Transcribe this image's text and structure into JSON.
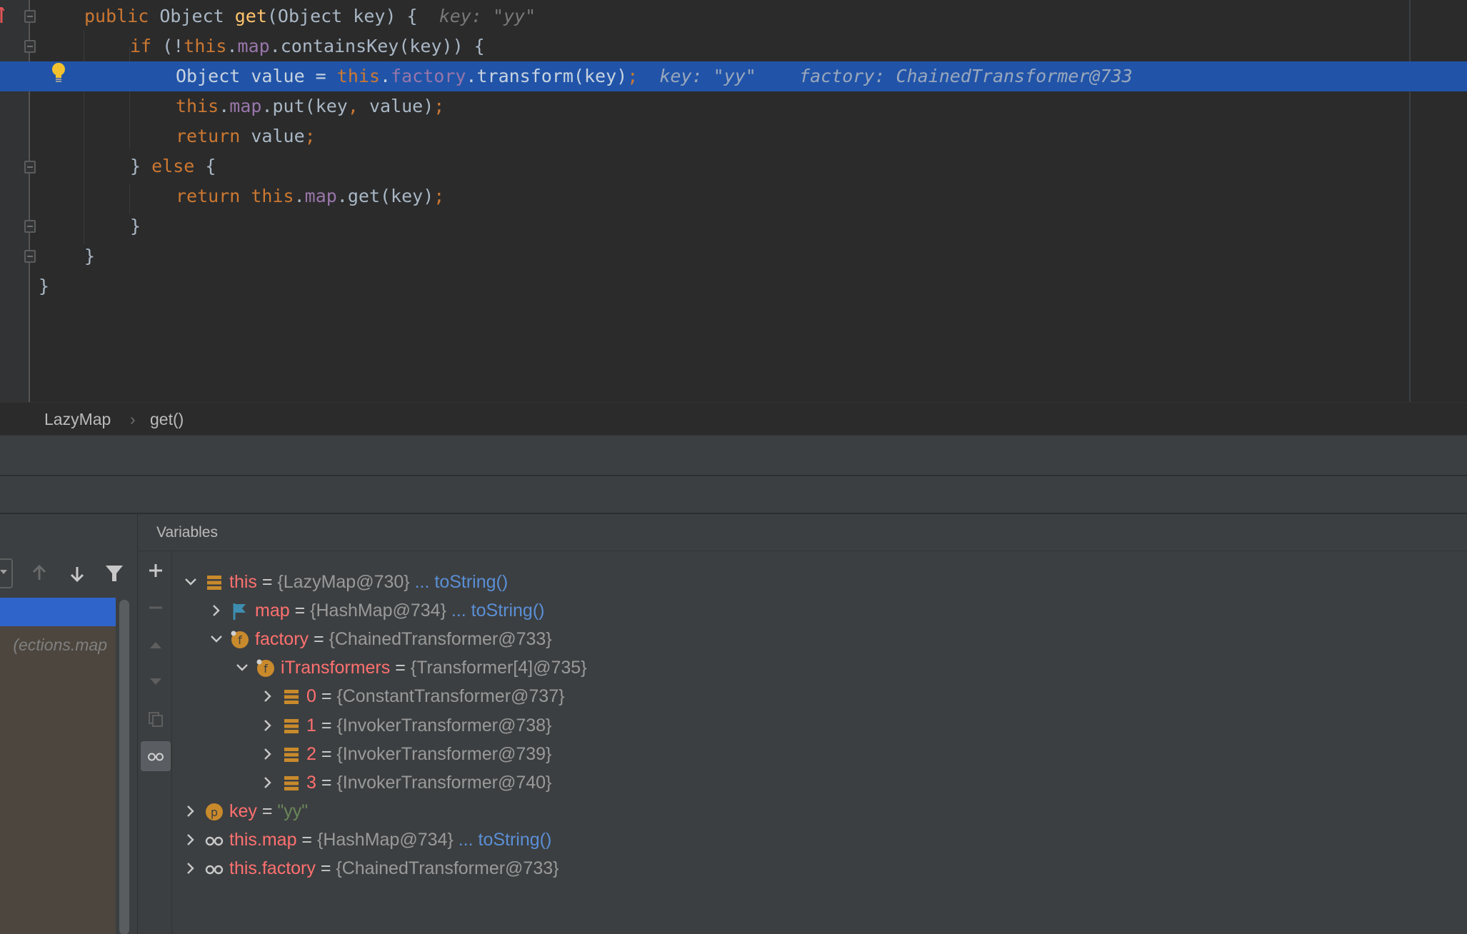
{
  "editor": {
    "lines": [
      [
        {
          "t": "public ",
          "c": "kw"
        },
        {
          "t": "Object ",
          "c": "pl"
        },
        {
          "t": "get",
          "c": "mth"
        },
        {
          "t": "(Object key) {",
          "c": "pl"
        },
        {
          "t": "  key: \"yy\"",
          "c": "hint"
        }
      ],
      [
        {
          "t": "if ",
          "c": "kw"
        },
        {
          "t": "(!",
          "c": "pl"
        },
        {
          "t": "this",
          "c": "kw"
        },
        {
          "t": ".",
          "c": "pl"
        },
        {
          "t": "map",
          "c": "fld"
        },
        {
          "t": ".containsKey(key)) {",
          "c": "pl"
        }
      ],
      [
        {
          "t": "Object value = ",
          "c": "pl"
        },
        {
          "t": "this",
          "c": "kw"
        },
        {
          "t": ".",
          "c": "pl"
        },
        {
          "t": "factory",
          "c": "fld"
        },
        {
          "t": ".transform(key)",
          "c": "pl"
        },
        {
          "t": ";",
          "c": "kw"
        },
        {
          "t": "  key: \"yy\"    factory: ChainedTransformer@733",
          "c": "hint"
        }
      ],
      [
        {
          "t": "this",
          "c": "kw"
        },
        {
          "t": ".",
          "c": "pl"
        },
        {
          "t": "map",
          "c": "fld"
        },
        {
          "t": ".put(key",
          "c": "pl"
        },
        {
          "t": ", ",
          "c": "kw"
        },
        {
          "t": "value)",
          "c": "pl"
        },
        {
          "t": ";",
          "c": "kw"
        }
      ],
      [
        {
          "t": "return ",
          "c": "kw"
        },
        {
          "t": "value",
          "c": "pl"
        },
        {
          "t": ";",
          "c": "kw"
        }
      ],
      [
        {
          "t": "} ",
          "c": "pl"
        },
        {
          "t": "else ",
          "c": "kw"
        },
        {
          "t": "{",
          "c": "pl"
        }
      ],
      [
        {
          "t": "return ",
          "c": "kw"
        },
        {
          "t": "this",
          "c": "kw"
        },
        {
          "t": ".",
          "c": "pl"
        },
        {
          "t": "map",
          "c": "fld"
        },
        {
          "t": ".get(key)",
          "c": "pl"
        },
        {
          "t": ";",
          "c": "kw"
        }
      ],
      [
        {
          "t": "}",
          "c": "pl"
        }
      ],
      [
        {
          "t": "}",
          "c": "pl"
        }
      ],
      [
        {
          "t": "}",
          "c": "pl"
        }
      ]
    ]
  },
  "breadcrumb": {
    "class_name": "LazyMap",
    "separator": "›",
    "method_name": "get()"
  },
  "frames": {
    "visible_frame_text": "ections.map)"
  },
  "variables": {
    "title": "Variables",
    "rows": [
      {
        "name": "this",
        "eq": " = ",
        "value": "{LazyMap@730}",
        "link": " ... toString()",
        "icon": "field-bars-icon",
        "expanded": true,
        "expandable": true
      },
      {
        "name": "map",
        "eq": " = ",
        "value": "{HashMap@734}",
        "link": " ... toString()",
        "icon": "flag-icon",
        "expanded": false,
        "expandable": true
      },
      {
        "name": "factory",
        "eq": " = ",
        "value": "{ChainedTransformer@733}",
        "link": "",
        "icon": "final-field-icon",
        "expanded": true,
        "expandable": true
      },
      {
        "name": "iTransformers",
        "eq": " = ",
        "value": "{Transformer[4]@735}",
        "link": "",
        "icon": "final-field-icon",
        "expanded": true,
        "expandable": true
      },
      {
        "name": "0",
        "eq": " = ",
        "value": "{ConstantTransformer@737}",
        "link": "",
        "icon": "field-bars-icon",
        "expanded": false,
        "expandable": true
      },
      {
        "name": "1",
        "eq": " = ",
        "value": "{InvokerTransformer@738}",
        "link": "",
        "icon": "field-bars-icon",
        "expanded": false,
        "expandable": true
      },
      {
        "name": "2",
        "eq": " = ",
        "value": "{InvokerTransformer@739}",
        "link": "",
        "icon": "field-bars-icon",
        "expanded": false,
        "expandable": true
      },
      {
        "name": "3",
        "eq": " = ",
        "value": "{InvokerTransformer@740}",
        "link": "",
        "icon": "field-bars-icon",
        "expanded": false,
        "expandable": true
      },
      {
        "name": "key",
        "eq": " = ",
        "value": "\"yy\"",
        "link": "",
        "icon": "parameter-icon",
        "expanded": false,
        "expandable": true,
        "string": true
      },
      {
        "name": "this.map",
        "eq": " = ",
        "value": "{HashMap@734}",
        "link": " ... toString()",
        "icon": "watch-glasses-icon",
        "expanded": false,
        "expandable": true
      },
      {
        "name": "this.factory",
        "eq": " = ",
        "value": "{ChainedTransformer@733}",
        "link": "",
        "icon": "watch-glasses-icon",
        "expanded": false,
        "expandable": true
      }
    ]
  },
  "colors": {
    "editor_bg": "#2b2b2b",
    "current_line": "#2154a8",
    "keyword": "#cc7832",
    "field": "#9876aa",
    "method": "#ffc66d",
    "variable_name": "#ff7070",
    "link": "#5a8fd6",
    "icon_orange": "#c98a2c"
  }
}
